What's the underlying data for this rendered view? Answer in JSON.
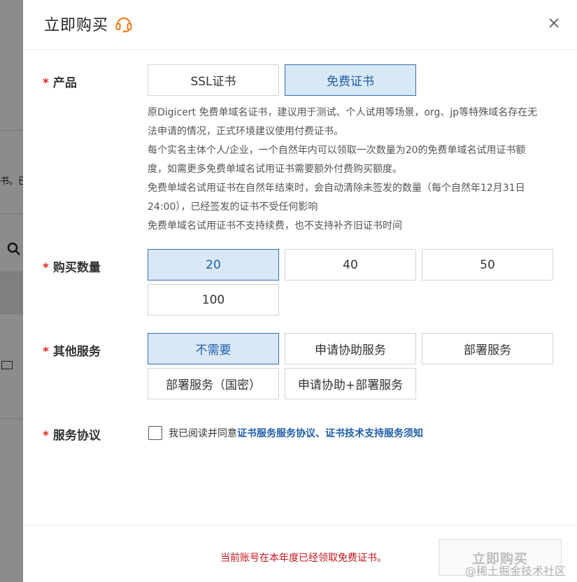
{
  "background_page": {
    "fragment_text": "书。已"
  },
  "dialog": {
    "title": "立即购买",
    "product": {
      "label": "产品",
      "options": [
        "SSL证书",
        "免费证书"
      ],
      "selected": "免费证书"
    },
    "description": [
      "原Digicert 免费单域名证书，建议用于测试、个人试用等场景，org、jp等特殊域名存在无",
      "法申请的情况，正式环境建议使用付费证书。",
      "每个实名主体个人/企业，一个自然年内可以领取一次数量为20的免费单域名试用证书额",
      "度，如需更多免费单域名试用证书需要额外付费购买额度。",
      "免费单域名试用证书在自然年结束时，会自动清除未签发的数量（每个自然年12月31日",
      "24:00），已经签发的证书不受任何影响",
      "免费单域名试用证书不支持续费，也不支持补齐旧证书时间"
    ],
    "quantity": {
      "label": "购买数量",
      "options": [
        "20",
        "40",
        "50",
        "100"
      ],
      "selected": "20"
    },
    "services": {
      "label": "其他服务",
      "options": [
        "不需要",
        "申请协助服务",
        "部署服务",
        "部署服务（国密）",
        "申请协助+部署服务"
      ],
      "selected": "不需要"
    },
    "agreement": {
      "label": "服务协议",
      "checked": false,
      "prefix": "我已阅读并同意",
      "link1": "证书服务服务协议",
      "separator": "、",
      "link2": "证书技术支持服务须知"
    },
    "footer": {
      "notice": "当前账号在本年度已经领取免费证书。",
      "buy_label": "立即购买",
      "watermark": "@稀土掘金技术社区"
    }
  },
  "colors": {
    "required_star": "#e0261f",
    "selected_bg": "#d8e8f7",
    "selected_border": "#2f6fb3",
    "link": "#1f5ea8",
    "notice": "#c7161c",
    "headset_icon": "#f07c1e"
  },
  "icons": [
    "headset-icon",
    "close-icon",
    "search-icon",
    "monitor-icon"
  ]
}
